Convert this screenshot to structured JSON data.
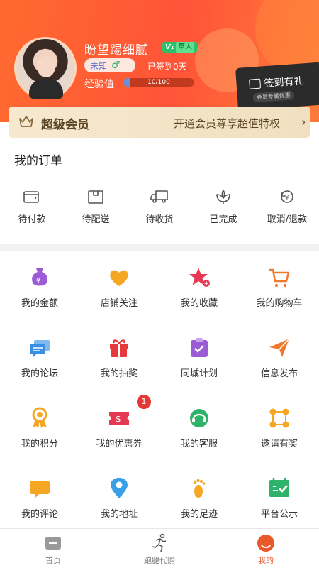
{
  "profile": {
    "username": "盼望踢细腻",
    "badge_v": "V₁",
    "badge_level": "草人",
    "gender_text": "未知",
    "gender_symbol": "♂",
    "signed_text": "已签到0天",
    "exp_label": "经验值",
    "exp_value": "10/100",
    "exp_progress_percent": 10
  },
  "signin": {
    "label": "签到有礼",
    "sub": "会员专属优惠"
  },
  "vip": {
    "title": "超级会员",
    "desc": "开通会员尊享超值特权",
    "chevron": "›"
  },
  "orders": {
    "title": "我的订单",
    "items": [
      {
        "label": "待付款",
        "icon": "wallet-icon"
      },
      {
        "label": "待配送",
        "icon": "box-icon"
      },
      {
        "label": "待收货",
        "icon": "truck-icon"
      },
      {
        "label": "已完成",
        "icon": "flower-icon"
      },
      {
        "label": "取消/退款",
        "icon": "refund-icon"
      }
    ]
  },
  "services": [
    {
      "label": "我的金额",
      "icon": "money-bag-icon",
      "color": "#9b5cd6"
    },
    {
      "label": "店铺关注",
      "icon": "heart-icon",
      "color": "#f5a623"
    },
    {
      "label": "我的收藏",
      "icon": "star-icon",
      "color": "#e53852"
    },
    {
      "label": "我的购物车",
      "icon": "cart-icon",
      "color": "#f07a2e"
    },
    {
      "label": "我的论坛",
      "icon": "chat-icon",
      "color": "#3a8ee6"
    },
    {
      "label": "我的抽奖",
      "icon": "gift-icon",
      "color": "#e5393b"
    },
    {
      "label": "同城计划",
      "icon": "clipboard-icon",
      "color": "#9b5cd6"
    },
    {
      "label": "信息发布",
      "icon": "send-icon",
      "color": "#f07a2e"
    },
    {
      "label": "我的积分",
      "icon": "medal-icon",
      "color": "#f5a623"
    },
    {
      "label": "我的优惠券",
      "icon": "coupon-icon",
      "color": "#e53852"
    },
    {
      "label": "我的客服",
      "icon": "headset-icon",
      "color": "#2fb36a"
    },
    {
      "label": "邀请有奖",
      "icon": "share-icon",
      "color": "#f5a623"
    },
    {
      "label": "我的评论",
      "icon": "comment-icon",
      "color": "#f5a623"
    },
    {
      "label": "我的地址",
      "icon": "location-icon",
      "color": "#3a9fe6"
    },
    {
      "label": "我的足迹",
      "icon": "footprint-icon",
      "color": "#f5a623"
    },
    {
      "label": "平台公示",
      "icon": "announce-icon",
      "color": "#2fb36a"
    }
  ],
  "coupon_badge": "1",
  "tabs": [
    {
      "label": "首页",
      "icon": "home-icon",
      "active": false
    },
    {
      "label": "跑腿代购",
      "icon": "runner-icon",
      "active": false
    },
    {
      "label": "我的",
      "icon": "profile-icon",
      "active": true
    }
  ],
  "colors": {
    "accent": "#ff5a36",
    "vip_bg": "#f6e9cf",
    "active_tab": "#e85a2c"
  }
}
